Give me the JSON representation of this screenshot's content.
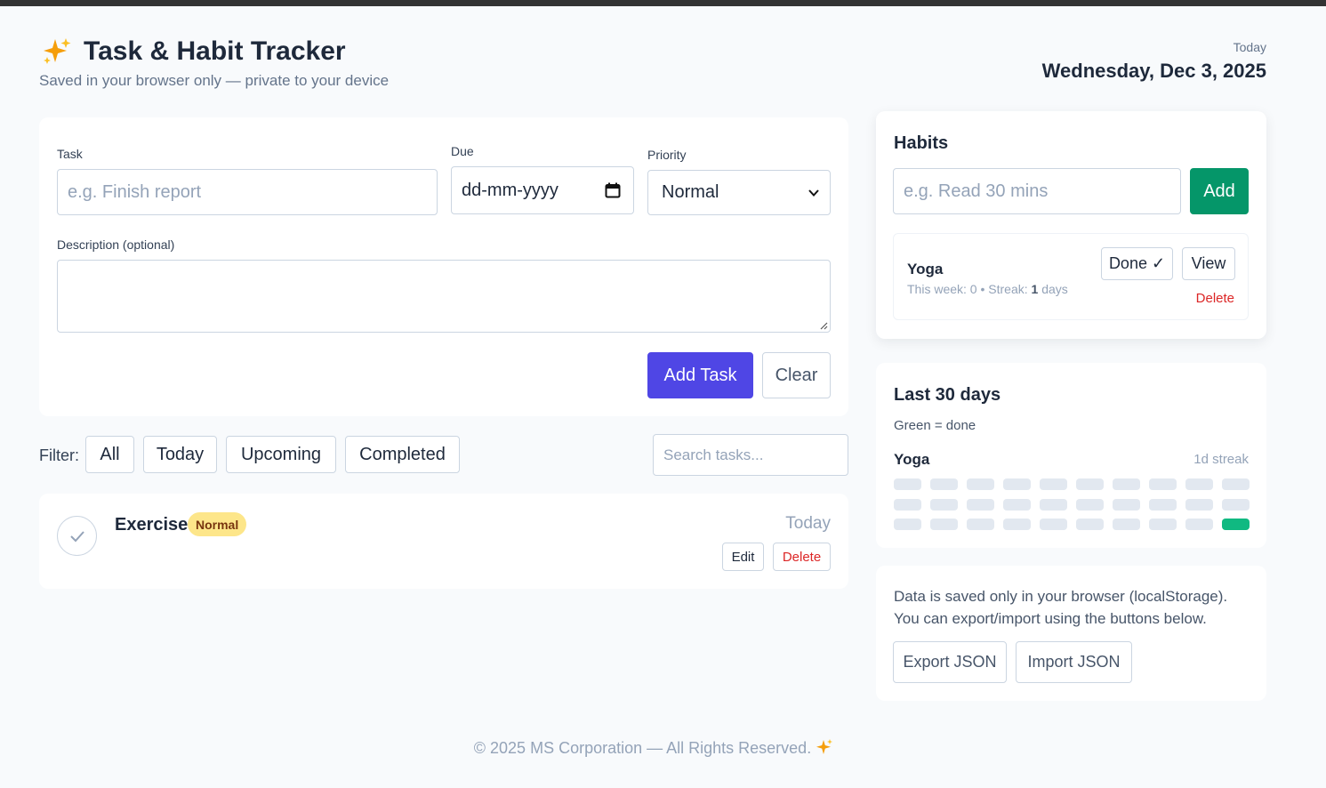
{
  "app": {
    "title": "Task & Habit Tracker",
    "subtitle": "Saved in your browser only — private to your device",
    "today_label": "Today",
    "today_date": "Wednesday, Dec 3, 2025"
  },
  "task_form": {
    "task_label": "Task",
    "task_placeholder": "e.g. Finish report",
    "due_label": "Due",
    "due_placeholder": "dd-mm-yyyy",
    "priority_label": "Priority",
    "priority_value": "Normal",
    "description_label": "Description (optional)",
    "description_value": "",
    "add_label": "Add Task",
    "clear_label": "Clear"
  },
  "filters": {
    "label": "Filter:",
    "buttons": [
      "All",
      "Today",
      "Upcoming",
      "Completed"
    ],
    "search_placeholder": "Search tasks..."
  },
  "tasks": [
    {
      "title": "Exercise",
      "priority": "Normal",
      "due": "Today",
      "completed": false,
      "edit_label": "Edit",
      "delete_label": "Delete"
    }
  ],
  "habits": {
    "title": "Habits",
    "input_placeholder": "e.g. Read 30 mins",
    "add_label": "Add",
    "items": [
      {
        "name": "Yoga",
        "week_text": "This week: 0 • Streak:",
        "streak_value": "1",
        "streak_unit": "days",
        "done_label": "Done ✓",
        "view_label": "View",
        "delete_label": "Delete"
      }
    ]
  },
  "last30": {
    "title": "Last 30 days",
    "note": "Green = done",
    "habit_name": "Yoga",
    "streak_label": "1d streak",
    "days_done": [
      false,
      false,
      false,
      false,
      false,
      false,
      false,
      false,
      false,
      false,
      false,
      false,
      false,
      false,
      false,
      false,
      false,
      false,
      false,
      false,
      false,
      false,
      false,
      false,
      false,
      false,
      false,
      false,
      false,
      true
    ]
  },
  "data_panel": {
    "note": "Data is saved only in your browser (localStorage). You can export/import using the buttons below.",
    "export_label": "Export JSON",
    "import_label": "Import JSON"
  },
  "footer": {
    "text": "© 2025 MS Corporation — All Rights Reserved."
  },
  "colors": {
    "primary": "#4f46e5",
    "success": "#059669",
    "heat_done": "#10b981",
    "heat_empty": "#e2e8f0",
    "danger": "#dc2626",
    "badge_bg": "#fde68a"
  }
}
